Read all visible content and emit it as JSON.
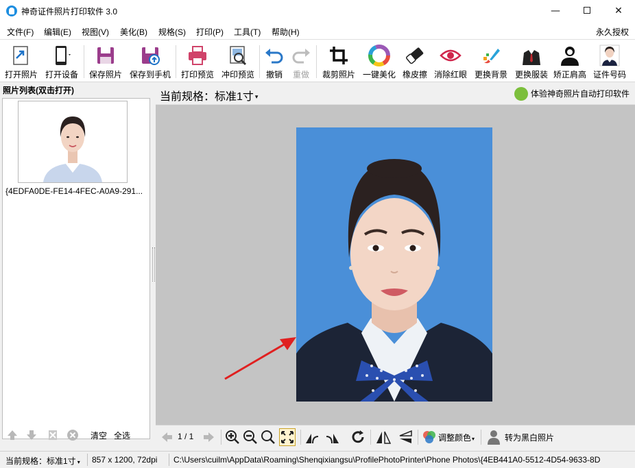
{
  "window": {
    "title": "神奇证件照片打印软件 3.0",
    "minimize": "—",
    "close": "✕"
  },
  "menu": {
    "items": [
      "文件(F)",
      "编辑(E)",
      "视图(V)",
      "美化(B)",
      "规格(S)",
      "打印(P)",
      "工具(T)",
      "帮助(H)"
    ],
    "license": "永久授权"
  },
  "toolbar": {
    "open_photo": "打开照片",
    "open_device": "打开设备",
    "save_photo": "保存照片",
    "save_to_phone": "保存到手机",
    "print_preview": "打印预览",
    "develop_preview": "冲印预览",
    "undo": "撤销",
    "redo": "重做",
    "crop": "裁剪照片",
    "beautify": "一键美化",
    "eraser": "橡皮擦",
    "red_eye": "消除红眼",
    "change_bg": "更换背景",
    "change_clothes": "更换服装",
    "fix_shoulder": "矫正肩高",
    "id_number": "证件号码"
  },
  "left_panel": {
    "header": "照片列表(双击打开)",
    "photos": [
      {
        "name": "{4EDFA0DE-FE14-4FEC-A0A9-291..."
      }
    ],
    "clear": "清空",
    "select_all": "全选"
  },
  "main": {
    "spec_label": "当前规格：标准1寸",
    "promo": "体验神奇照片自动打印软件",
    "background_color": "#4a8fd8"
  },
  "bottom_toolbar": {
    "page": "1 / 1",
    "adjust_color": "调整颜色",
    "to_bw": "转为黑白照片"
  },
  "status": {
    "spec": "当前规格：标准1寸",
    "size": "857 x 1200, 72dpi",
    "path": "C:\\Users\\cuilm\\AppData\\Roaming\\Shenqixiangsu\\ProfilePhotoPrinter\\Phone Photos\\{4EB441A0-5512-4D54-9633-8D"
  }
}
